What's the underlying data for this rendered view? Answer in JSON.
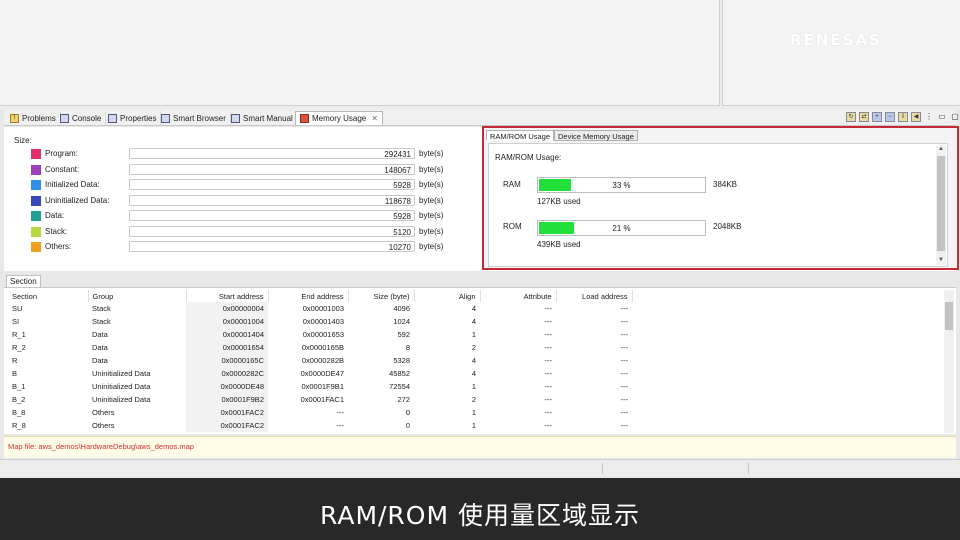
{
  "logo": "RENESAS",
  "tabs": [
    {
      "label": "Problems",
      "icon": "problems-icon"
    },
    {
      "label": "Console",
      "icon": "console-icon"
    },
    {
      "label": "Properties",
      "icon": "properties-icon"
    },
    {
      "label": "Smart Browser",
      "icon": "smart-browser-icon"
    },
    {
      "label": "Smart Manual",
      "icon": "smart-manual-icon"
    },
    {
      "label": "Memory Usage",
      "icon": "memory-usage-icon",
      "active": true
    }
  ],
  "size": {
    "label": "Size:",
    "unit": "byte(s)",
    "rows": [
      {
        "name": "Program:",
        "value": "292431",
        "color": "#e0306a"
      },
      {
        "name": "Constant:",
        "value": "148067",
        "color": "#a040b8"
      },
      {
        "name": "Initialized Data:",
        "value": "5928",
        "color": "#3090e8"
      },
      {
        "name": "Uninitialized Data:",
        "value": "118678",
        "color": "#3848b8"
      },
      {
        "name": "Data:",
        "value": "5928",
        "color": "#20a090"
      },
      {
        "name": "Stack:",
        "value": "5120",
        "color": "#b8d840"
      },
      {
        "name": "Others:",
        "value": "10270",
        "color": "#f0a020"
      }
    ]
  },
  "ram_panel": {
    "tabs": [
      "RAM/ROM Usage",
      "Device Memory Usage"
    ],
    "title": "RAM/ROM Usage:",
    "ram": {
      "label": "RAM",
      "percent_text": "33 %",
      "fraction": 0.19,
      "total": "384KB",
      "used": "127KB used"
    },
    "rom": {
      "label": "ROM",
      "percent_text": "21 %",
      "fraction": 0.21,
      "total": "2048KB",
      "used": "439KB used"
    }
  },
  "section_tab": "Section",
  "table": {
    "headers": [
      "Section",
      "Group",
      "Start address",
      "End address",
      "Size (byte)",
      "Align",
      "Attribute",
      "Load address"
    ],
    "rows": [
      [
        "SU",
        "Stack",
        "0x00000004",
        "0x00001003",
        "4096",
        "4",
        "---",
        "---"
      ],
      [
        "SI",
        "Stack",
        "0x00001004",
        "0x00001403",
        "1024",
        "4",
        "---",
        "---"
      ],
      [
        "R_1",
        "Data",
        "0x00001404",
        "0x00001653",
        "592",
        "1",
        "---",
        "---"
      ],
      [
        "R_2",
        "Data",
        "0x00001654",
        "0x0000165B",
        "8",
        "2",
        "---",
        "---"
      ],
      [
        "R",
        "Data",
        "0x0000165C",
        "0x0000282B",
        "5328",
        "4",
        "---",
        "---"
      ],
      [
        "B",
        "Uninitialized Data",
        "0x0000282C",
        "0x0000DE47",
        "45852",
        "4",
        "---",
        "---"
      ],
      [
        "B_1",
        "Uninitialized Data",
        "0x0000DE48",
        "0x0001F9B1",
        "72554",
        "1",
        "---",
        "---"
      ],
      [
        "B_2",
        "Uninitialized Data",
        "0x0001F9B2",
        "0x0001FAC1",
        "272",
        "2",
        "---",
        "---"
      ],
      [
        "B_8",
        "Others",
        "0x0001FAC2",
        "---",
        "0",
        "1",
        "---",
        "---"
      ],
      [
        "R_8",
        "Others",
        "0x0001FAC2",
        "---",
        "0",
        "1",
        "---",
        "---"
      ]
    ]
  },
  "map_file": "Map file: aws_demos\\HardwareDebug\\aws_demos.map",
  "caption": "RAM/ROM 使用量区域显示"
}
